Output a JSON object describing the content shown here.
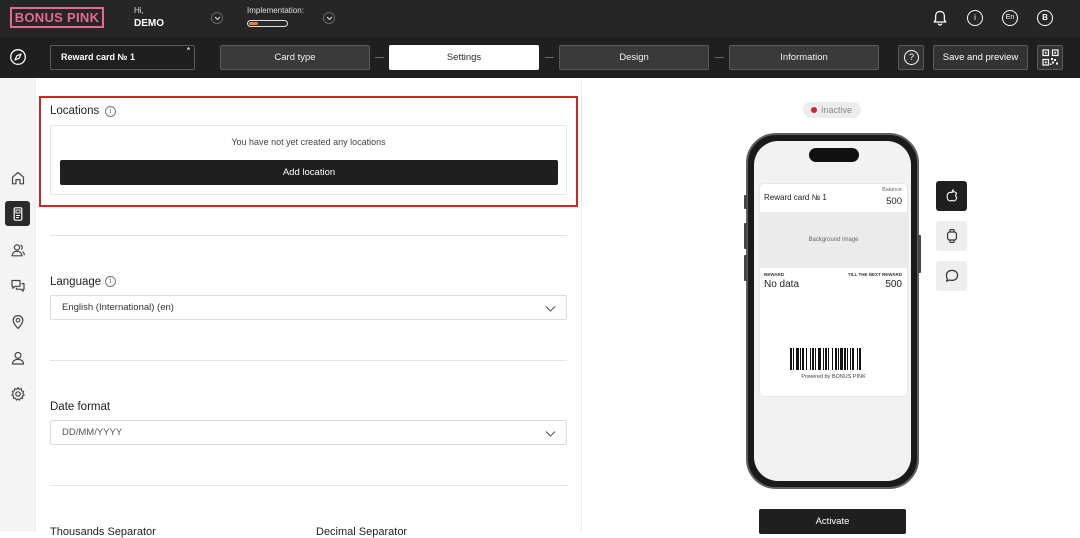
{
  "topbar": {
    "logo_text": "BONUS PINK",
    "greeting": "Hi,",
    "user_name": "DEMO",
    "implementation_label": "Implementation:",
    "implementation_progress": 0.22,
    "language_badge": "En",
    "avatar_initial": "B",
    "info_glyph": "i"
  },
  "subbar": {
    "card_name": "Reward card № 1",
    "required_mark": "*",
    "steps": [
      {
        "label": "Card type",
        "active": false
      },
      {
        "label": "Settings",
        "active": true
      },
      {
        "label": "Design",
        "active": false
      },
      {
        "label": "Information",
        "active": false
      }
    ],
    "help_glyph": "?",
    "save_label": "Save and preview"
  },
  "sidebar": {
    "items": [
      {
        "icon": "home-icon",
        "active": false
      },
      {
        "icon": "card-icon",
        "active": true
      },
      {
        "icon": "users-icon",
        "active": false
      },
      {
        "icon": "chat-icon",
        "active": false
      },
      {
        "icon": "location-pin-icon",
        "active": false
      },
      {
        "icon": "user-icon",
        "active": false
      },
      {
        "icon": "gear-icon",
        "active": false
      }
    ]
  },
  "settings": {
    "locations": {
      "title": "Locations",
      "empty_message": "You have not yet created any locations",
      "add_button": "Add location"
    },
    "language": {
      "title": "Language",
      "value": "English (International) (en)"
    },
    "date_format": {
      "title": "Date format",
      "placeholder": "DD/MM/YYYY"
    },
    "thousands_separator_label": "Thousands Separator",
    "decimal_separator_label": "Decimal Separator",
    "info_glyph": "i"
  },
  "preview": {
    "status": "Inactive",
    "pass": {
      "name": "Reward card № 1",
      "balance_label": "Balance",
      "balance_value": "500",
      "background_label": "Background image",
      "reward_label": "REWARD",
      "reward_value": "No data",
      "next_reward_label": "TILL THE NEXT REWARD",
      "next_reward_value": "500",
      "powered_by": "Powered by BONUS PINK"
    },
    "platforms": [
      "apple-icon",
      "smartwatch-icon",
      "message-icon"
    ],
    "activate_button": "Activate"
  },
  "colors": {
    "brand_pink": "#e56b91",
    "topbar_bg": "#262626",
    "progress_orange": "#ef7d2b",
    "highlight_red": "#d32323",
    "status_red": "#d6222f"
  }
}
